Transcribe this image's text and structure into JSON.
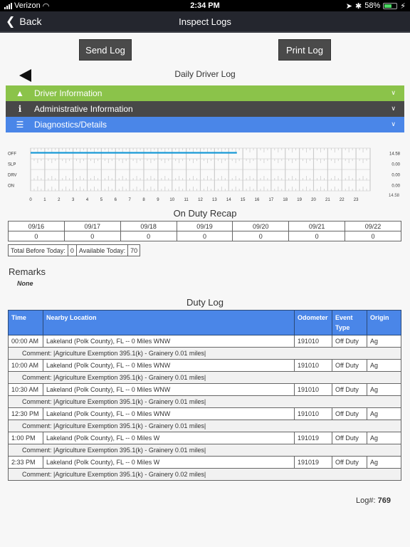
{
  "status_bar": {
    "carrier": "Verizon",
    "time": "2:34 PM",
    "battery": "58%"
  },
  "nav": {
    "back_label": "Back",
    "title": "Inspect Logs"
  },
  "actions": {
    "send_label": "Send Log",
    "print_label": "Print Log"
  },
  "log_header": {
    "title": "Daily Driver Log"
  },
  "sections": [
    {
      "label": "Driver Information",
      "icon": "user-icon",
      "color": "#8bc34a"
    },
    {
      "label": "Administrative Information",
      "icon": "info-icon",
      "color": "#484848"
    },
    {
      "label": "Diagnostics/Details",
      "icon": "list-icon",
      "color": "#4a86e8"
    }
  ],
  "chart_data": {
    "type": "line",
    "title": "",
    "rows": [
      "OFF",
      "SLP",
      "DRV",
      "ON"
    ],
    "x_ticks": [
      "0",
      "1",
      "2",
      "3",
      "4",
      "5",
      "6",
      "7",
      "8",
      "9",
      "10",
      "11",
      "12",
      "13",
      "14",
      "15",
      "16",
      "17",
      "18",
      "19",
      "20",
      "21",
      "22",
      "23"
    ],
    "xlim": [
      0,
      24
    ],
    "segments": [
      {
        "status": "OFF",
        "start": 0,
        "end": 14.58
      }
    ],
    "row_totals": {
      "OFF": "14.58",
      "SLP": "0.00",
      "DRV": "0.00",
      "ON": "0.00"
    },
    "grand_total": "14.58",
    "line_color": "#1a9ad6"
  },
  "recap": {
    "title": "On Duty Recap",
    "dates": [
      "09/16",
      "09/17",
      "09/18",
      "09/19",
      "09/20",
      "09/21",
      "09/22"
    ],
    "values": [
      "0",
      "0",
      "0",
      "0",
      "0",
      "0",
      "0"
    ],
    "total_before_label": "Total Before Today:",
    "total_before_value": "0",
    "available_label": "Available Today:",
    "available_value": "70"
  },
  "remarks": {
    "title": "Remarks",
    "value": "None"
  },
  "duty_log": {
    "title": "Duty Log",
    "headers": {
      "time": "Time",
      "location": "Nearby Location",
      "odometer": "Odometer",
      "event": "Event Type",
      "origin": "Origin"
    },
    "rows": [
      {
        "time": "00:00 AM",
        "location": "Lakeland (Polk County), FL -- 0 Miles WNW",
        "odometer": "191010",
        "event": "Off Duty",
        "origin": "Ag",
        "comment": "Comment:  |Agriculture Exemption 395.1(k) - Grainery 0.01 miles|"
      },
      {
        "time": "10:00 AM",
        "location": "Lakeland (Polk County), FL -- 0 Miles WNW",
        "odometer": "191010",
        "event": "Off Duty",
        "origin": "Ag",
        "comment": "Comment: |Agriculture Exemption 395.1(k) - Grainery 0.01 miles|"
      },
      {
        "time": "10:30 AM",
        "location": "Lakeland (Polk County), FL -- 0 Miles WNW",
        "odometer": "191010",
        "event": "Off Duty",
        "origin": "Ag",
        "comment": "Comment: |Agriculture Exemption 395.1(k) - Grainery 0.01 miles|"
      },
      {
        "time": "12:30 PM",
        "location": "Lakeland (Polk County), FL -- 0 Miles WNW",
        "odometer": "191010",
        "event": "Off Duty",
        "origin": "Ag",
        "comment": "Comment: |Agriculture Exemption 395.1(k) - Grainery 0.01 miles|"
      },
      {
        "time": "1:00 PM",
        "location": "Lakeland (Polk County), FL -- 0 Miles W",
        "odometer": "191019",
        "event": "Off Duty",
        "origin": "Ag",
        "comment": "Comment: |Agriculture Exemption 395.1(k) - Grainery 0.01 miles|"
      },
      {
        "time": "2:33 PM",
        "location": "Lakeland (Polk County), FL -- 0 Miles W",
        "odometer": "191019",
        "event": "Off Duty",
        "origin": "Ag",
        "comment": "Comment: |Agriculture Exemption 395.1(k) - Grainery 0.02 miles|"
      }
    ]
  },
  "log_number": {
    "label": "Log#:",
    "value": "769"
  }
}
